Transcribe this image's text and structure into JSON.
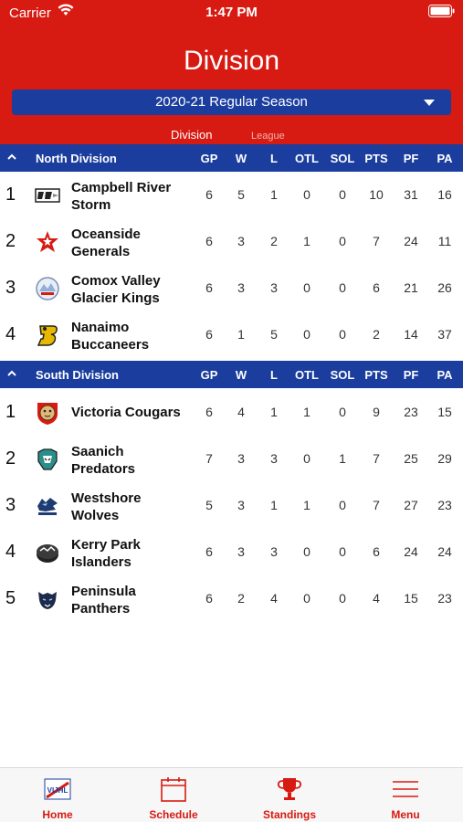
{
  "status": {
    "carrier": "Carrier",
    "time": "1:47 PM"
  },
  "header": {
    "title": "Division",
    "season": "2020-21 Regular Season",
    "segments": {
      "division": "Division",
      "league": "League"
    }
  },
  "columns": [
    "GP",
    "W",
    "L",
    "OTL",
    "SOL",
    "PTS",
    "PF",
    "PA"
  ],
  "divisions": [
    {
      "name": "North Division",
      "teams": [
        {
          "rank": "1",
          "line1": "Campbell River",
          "line2": "Storm",
          "gp": "6",
          "w": "5",
          "l": "1",
          "otl": "0",
          "sol": "0",
          "pts": "10",
          "pf": "31",
          "pa": "16"
        },
        {
          "rank": "2",
          "line1": "Oceanside",
          "line2": "Generals",
          "gp": "6",
          "w": "3",
          "l": "2",
          "otl": "1",
          "sol": "0",
          "pts": "7",
          "pf": "24",
          "pa": "11"
        },
        {
          "rank": "3",
          "line1": "Comox Valley",
          "line2": "Glacier Kings",
          "gp": "6",
          "w": "3",
          "l": "3",
          "otl": "0",
          "sol": "0",
          "pts": "6",
          "pf": "21",
          "pa": "26"
        },
        {
          "rank": "4",
          "line1": "Nanaimo",
          "line2": "Buccaneers",
          "gp": "6",
          "w": "1",
          "l": "5",
          "otl": "0",
          "sol": "0",
          "pts": "2",
          "pf": "14",
          "pa": "37"
        }
      ]
    },
    {
      "name": "South Division",
      "teams": [
        {
          "rank": "1",
          "line1": "Victoria Cougars",
          "line2": "",
          "gp": "6",
          "w": "4",
          "l": "1",
          "otl": "1",
          "sol": "0",
          "pts": "9",
          "pf": "23",
          "pa": "15"
        },
        {
          "rank": "2",
          "line1": "Saanich",
          "line2": "Predators",
          "gp": "7",
          "w": "3",
          "l": "3",
          "otl": "0",
          "sol": "1",
          "pts": "7",
          "pf": "25",
          "pa": "29"
        },
        {
          "rank": "3",
          "line1": "Westshore",
          "line2": "Wolves",
          "gp": "5",
          "w": "3",
          "l": "1",
          "otl": "1",
          "sol": "0",
          "pts": "7",
          "pf": "27",
          "pa": "23"
        },
        {
          "rank": "4",
          "line1": "Kerry Park",
          "line2": "Islanders",
          "gp": "6",
          "w": "3",
          "l": "3",
          "otl": "0",
          "sol": "0",
          "pts": "6",
          "pf": "24",
          "pa": "24"
        },
        {
          "rank": "5",
          "line1": "Peninsula",
          "line2": "Panthers",
          "gp": "6",
          "w": "2",
          "l": "4",
          "otl": "0",
          "sol": "0",
          "pts": "4",
          "pf": "15",
          "pa": "23"
        }
      ]
    }
  ],
  "tabs": [
    {
      "label": "Home",
      "icon": "vijhl-logo-icon"
    },
    {
      "label": "Schedule",
      "icon": "calendar-icon"
    },
    {
      "label": "Standings",
      "icon": "trophy-icon"
    },
    {
      "label": "Menu",
      "icon": "hamburger-menu-icon"
    }
  ],
  "logo_text": {
    "vijhl": "VIJHL"
  },
  "colors": {
    "header_red": "#d71a12",
    "division_blue": "#1a3d9e"
  }
}
